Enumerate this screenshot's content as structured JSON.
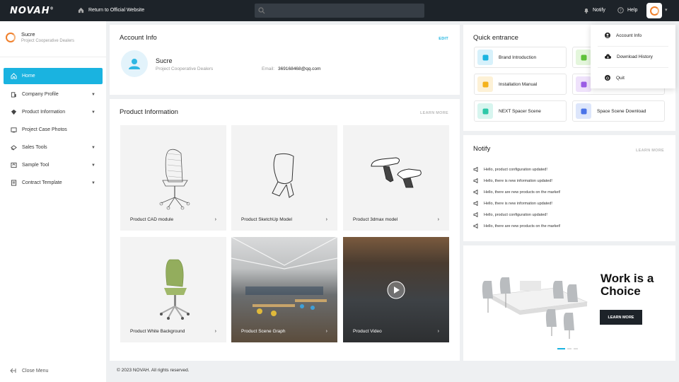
{
  "topbar": {
    "logo": "NOVAH",
    "return_label": "Return to Official Website",
    "notify_label": "Notify",
    "help_label": "Help"
  },
  "user": {
    "name": "Sucre",
    "role": "Project Cooperative Dealers",
    "email_label": "Email:",
    "email": "369168468@qq.com"
  },
  "sidebar": {
    "items": [
      {
        "label": "Home",
        "icon": "home-icon",
        "active": true,
        "has_children": false
      },
      {
        "label": "Company Profile",
        "icon": "building-icon",
        "has_children": true
      },
      {
        "label": "Product Information",
        "icon": "product-icon",
        "has_children": true
      },
      {
        "label": "Project Case Photos",
        "icon": "photo-icon",
        "has_children": false
      },
      {
        "label": "Sales Tools",
        "icon": "tools-icon",
        "has_children": true
      },
      {
        "label": "Sample Tool",
        "icon": "sample-icon",
        "has_children": true
      },
      {
        "label": "Contract Template",
        "icon": "contract-icon",
        "has_children": true
      }
    ],
    "close_menu": "Close Menu"
  },
  "account": {
    "title": "Account Info",
    "edit": "EDIT"
  },
  "products": {
    "title": "Product Information",
    "more": "LEARN MORE",
    "tiles": [
      {
        "label": "Product CAD module",
        "arrow": "›"
      },
      {
        "label": "Product SketchUp Model",
        "arrow": "›"
      },
      {
        "label": "Product 3dmax model",
        "arrow": "›"
      },
      {
        "label": "Product White Background",
        "arrow": "›"
      },
      {
        "label": "Product Scene Graph",
        "arrow": "›"
      },
      {
        "label": "Product Video",
        "arrow": "›"
      }
    ]
  },
  "quick": {
    "title": "Quick entrance",
    "items": [
      {
        "label": "Brand Introduction",
        "color": "#d7f1fb",
        "icon_color": "#1ab3e0"
      },
      {
        "label": "",
        "color": "#e4f6dc",
        "icon_color": "#5fc23a"
      },
      {
        "label": "Installation Manual",
        "color": "#fdf1d6",
        "icon_color": "#f4b21c"
      },
      {
        "label": "",
        "color": "#efe2fb",
        "icon_color": "#9b5de5"
      },
      {
        "label": "NEXT Spacer Scene",
        "color": "#d7f5ef",
        "icon_color": "#2cc8a8"
      },
      {
        "label": "Space Scene Download",
        "color": "#dde6fb",
        "icon_color": "#4a73e8"
      }
    ]
  },
  "notify": {
    "title": "Notify",
    "more": "LEARN MORE",
    "items": [
      "Hello, product configuration updated!",
      "Hello, there is new information updated!",
      "Hello, there are new products on the market!",
      "Hello, there is new information updated!",
      "Hello, product configuration updated!",
      "Hello, there are new products on the market!"
    ]
  },
  "banner": {
    "headline_1": "Work is a",
    "headline_2": "Choice",
    "button": "LEARN MORE"
  },
  "dropdown": {
    "items": [
      "Account Info",
      "Download History",
      "Quit"
    ]
  },
  "footer": "© 2023 NOVAH. All rights reserved."
}
